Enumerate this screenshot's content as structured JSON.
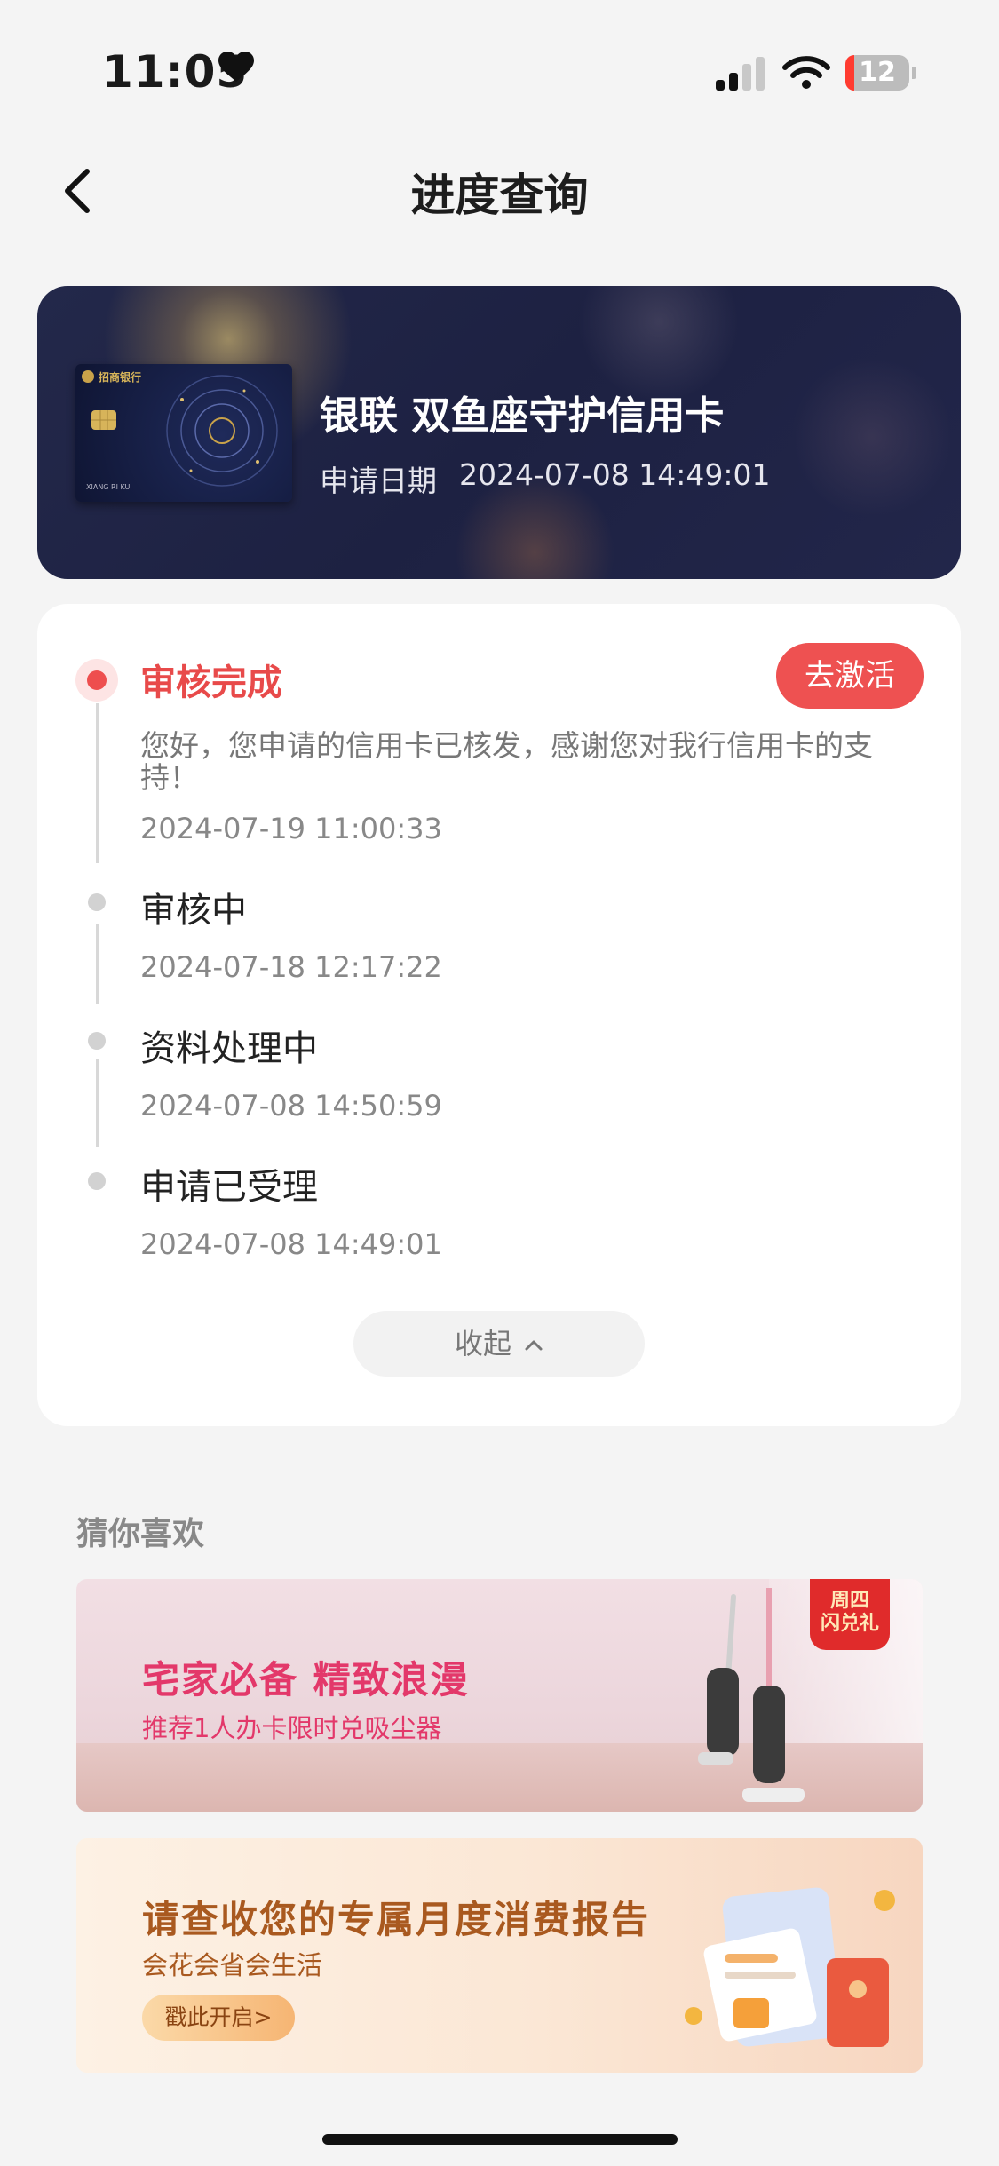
{
  "status_bar": {
    "time": "11:05",
    "battery": "12"
  },
  "nav": {
    "title": "进度查询"
  },
  "card": {
    "name": "银联 双鱼座守护信用卡",
    "date_label": "申请日期",
    "date_value": "2024-07-08 14:49:01",
    "bank_label": "招商银行",
    "holder": "XIANG RI KUI"
  },
  "progress": {
    "action_label": "去激活",
    "steps": [
      {
        "title": "审核完成",
        "desc": "您好，您申请的信用卡已核发，感谢您对我行信用卡的支持！",
        "time": "2024-07-19 11:00:33"
      },
      {
        "title": "审核中",
        "time": "2024-07-18 12:17:22"
      },
      {
        "title": "资料处理中",
        "time": "2024-07-08 14:50:59"
      },
      {
        "title": "申请已受理",
        "time": "2024-07-08 14:49:01"
      }
    ],
    "collapse_label": "收起"
  },
  "recommend": {
    "title": "猜你喜欢",
    "banners": [
      {
        "headline": "宅家必备 精致浪漫",
        "sub": "推荐1人办卡限时兑吸尘器",
        "badge_line1": "周四",
        "badge_line2": "闪兑礼"
      },
      {
        "headline": "请查收您的专属月度消费报告",
        "sub": "会花会省会生活",
        "button": "戳此开启>"
      }
    ]
  },
  "colors": {
    "accent": "#ee5151",
    "card_bg": "#1f2344",
    "page_bg": "#f4f4f4"
  },
  "icons": [
    "heart-icon",
    "signal-icon",
    "wifi-icon",
    "battery-icon",
    "back-icon",
    "chevron-up-icon",
    "chip-icon"
  ]
}
